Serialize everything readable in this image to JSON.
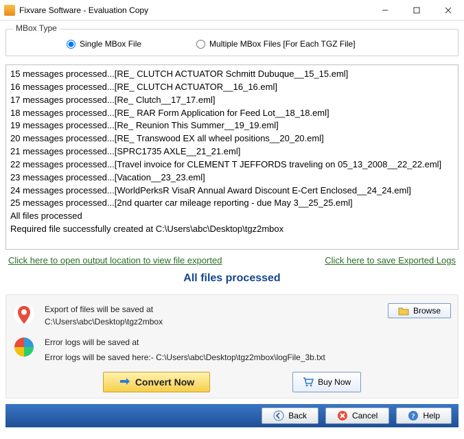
{
  "title": "Fixvare Software - Evaluation Copy",
  "group": {
    "label": "MBox Type",
    "opt1": "Single MBox File",
    "opt2": "Multiple MBox Files [For Each TGZ File]"
  },
  "log_lines": [
    "15 messages processed...[RE_ CLUTCH ACTUATOR Schmitt Dubuque__15_15.eml]",
    "16 messages processed...[RE_ CLUTCH ACTUATOR__16_16.eml]",
    "17 messages processed...[Re_ Clutch__17_17.eml]",
    "18 messages processed...[RE_ RAR Form Application for Feed Lot__18_18.eml]",
    "19 messages processed...[Re_ Reunion This Summer__19_19.eml]",
    "20 messages processed...[RE_ Transwood EX all wheel positions__20_20.eml]",
    "21 messages processed...[SPRC1735 AXLE__21_21.eml]",
    "22 messages processed...[Travel invoice for CLEMENT T JEFFORDS traveling on 05_13_2008__22_22.eml]",
    "23 messages processed...[Vacation__23_23.eml]",
    "24 messages processed...[WorldPerksR VisaR Annual Award Discount E-Cert Enclosed__24_24.eml]",
    "25 messages processed...[2nd quarter car mileage reporting - due May 3__25_25.eml]",
    "All files processed",
    "Required file successfully created at C:\\Users\\abc\\Desktop\\tgz2mbox"
  ],
  "links": {
    "open_output": "Click here to open output location to view file exported",
    "save_logs": "Click here to save Exported Logs"
  },
  "status": "All files processed",
  "export": {
    "label": "Export of files will be saved at",
    "path": "C:\\Users\\abc\\Desktop\\tgz2mbox",
    "browse": "Browse"
  },
  "errors": {
    "label": "Error logs will be saved at",
    "path": "Error logs will be saved here:- C:\\Users\\abc\\Desktop\\tgz2mbox\\logFile_3b.txt"
  },
  "actions": {
    "convert": "Convert Now",
    "buy": "Buy Now"
  },
  "footer": {
    "back": "Back",
    "cancel": "Cancel",
    "help": "Help"
  }
}
